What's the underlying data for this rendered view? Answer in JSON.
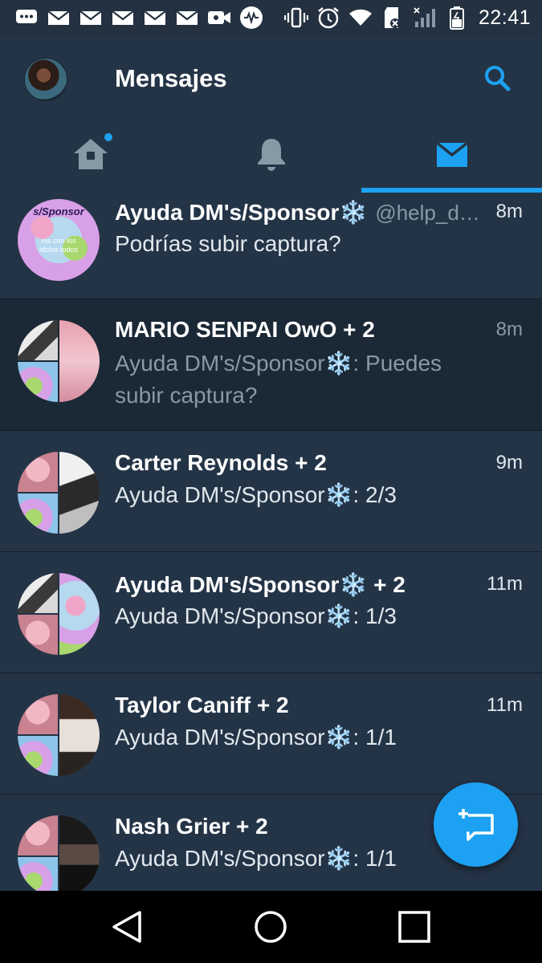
{
  "status_bar": {
    "time": "22:41",
    "left_icons": [
      "chat-bubble-icon",
      "mail-icon",
      "mail-icon",
      "mail-icon",
      "mail-icon",
      "mail-icon",
      "video-icon",
      "music-app-icon"
    ],
    "right_icons": [
      "vibrate-icon",
      "alarm-icon",
      "wifi-icon",
      "sd-card-icon",
      "signal-icon",
      "battery-icon"
    ]
  },
  "header": {
    "title": "Mensajes",
    "tabs": [
      {
        "name": "home",
        "icon": "home-icon",
        "has_notification": true
      },
      {
        "name": "notifications",
        "icon": "bell-icon",
        "has_notification": false
      },
      {
        "name": "messages",
        "icon": "mail-icon",
        "active": true
      }
    ]
  },
  "conversations": [
    {
      "name": "Ayuda DM's/Sponsor",
      "emoji": "❄️",
      "handle": "@help_d…",
      "time": "8m",
      "preview": "Podrías subir captura?"
    },
    {
      "name": "MARIO SENPAI OwO + 2",
      "time": "8m",
      "preview_line1": "Ayuda DM's/Sponsor❄️: Puedes",
      "preview_line2": "subir captura?"
    },
    {
      "name": "Carter Reynolds + 2",
      "time": "9m",
      "preview": "Ayuda DM's/Sponsor❄️: 2/3"
    },
    {
      "name_part1": "Ayuda DM's/Sponsor",
      "name_emoji": "❄️",
      "name_part2": " + 2",
      "time": "11m",
      "preview": "Ayuda DM's/Sponsor❄️: 1/3"
    },
    {
      "name": "Taylor Caniff + 2",
      "time": "11m",
      "preview": "Ayuda DM's/Sponsor❄️: 1/1"
    },
    {
      "name": "Nash Grier + 2",
      "time": "",
      "preview": "Ayuda DM's/Sponsor❄️: 1/1"
    }
  ],
  "colors": {
    "background": "#243447",
    "unread_background": "#1b2836",
    "accent": "#1da1f2",
    "text_secondary": "#8899a6"
  },
  "fab_icon": "new-message-icon",
  "nav": {
    "back": "back-icon",
    "home": "home-circle-icon",
    "recents": "recents-icon"
  }
}
